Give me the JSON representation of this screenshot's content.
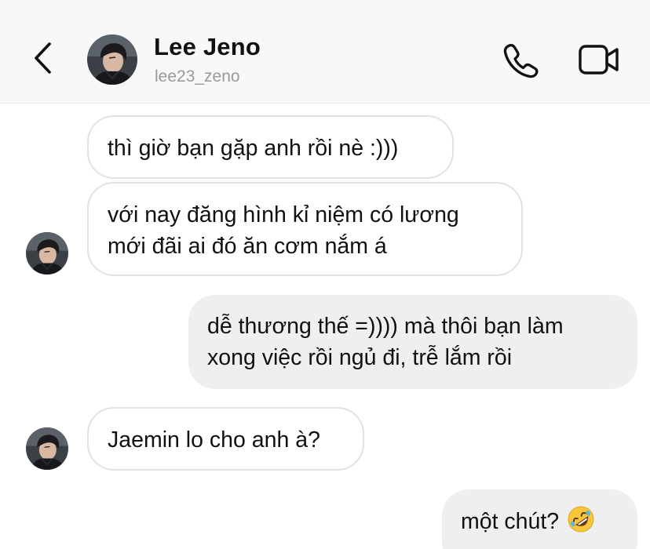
{
  "header": {
    "contact_name": "Lee Jeno",
    "username": "lee23_zeno",
    "back_icon": "chevron-left-icon",
    "call_icon": "phone-icon",
    "video_icon": "video-camera-icon"
  },
  "messages": [
    {
      "sender": "contact",
      "lines": [
        "thì giờ bạn gặp anh rồi nè :)))"
      ]
    },
    {
      "sender": "contact",
      "lines": [
        "với nay đăng hình kỉ niệm có lương",
        "mới đãi ai đó ăn cơm nắm á"
      ]
    },
    {
      "sender": "me",
      "lines": [
        "dễ thương thế =)))) mà thôi bạn làm",
        "xong việc rồi ngủ đi, trễ lắm rồi"
      ]
    },
    {
      "sender": "contact",
      "lines": [
        "Jaemin lo cho anh à?"
      ]
    },
    {
      "sender": "me",
      "lines": [
        "một chút?"
      ],
      "emoji": "rolling-on-floor-laughing-emoji"
    }
  ],
  "colors": {
    "header_bg": "#f8f8f8",
    "incoming_border": "#e2e2e2",
    "outgoing_bg": "#efefef",
    "username": "#9a9a9a",
    "text": "#111111"
  }
}
